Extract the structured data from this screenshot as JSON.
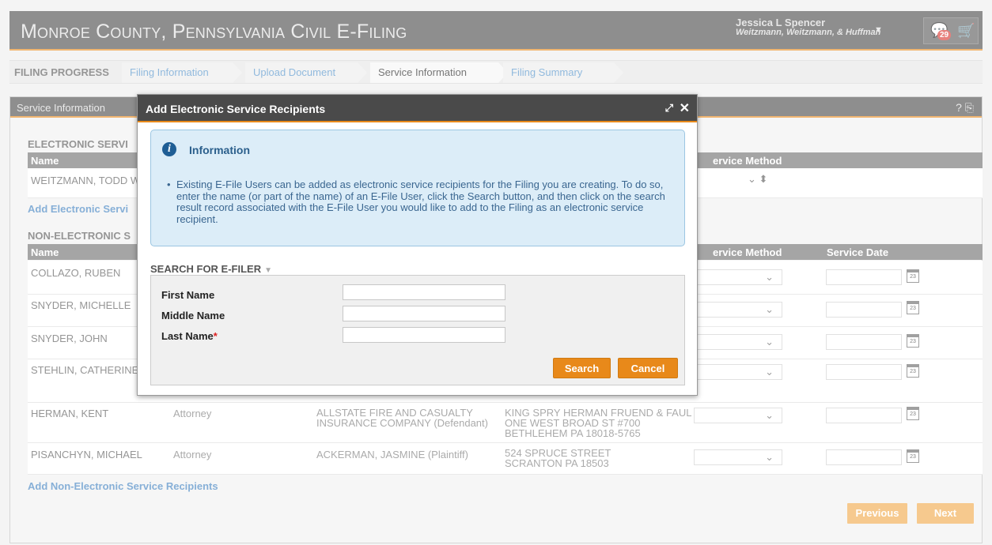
{
  "app": {
    "title": "Monroe County, Pennsylvania Civil E-Filing",
    "user_name": "Jessica L Spencer",
    "user_org": "Weitzmann, Weitzmann, & Huffman",
    "notification_count": "29",
    "icons": {
      "user_menu": "caret-down-icon",
      "messages": "chat-icon",
      "cart": "cart-icon"
    }
  },
  "progress": {
    "label": "FILING PROGRESS",
    "steps": [
      {
        "label": "Filing Information",
        "state": "link"
      },
      {
        "label": "Upload Document",
        "state": "link"
      },
      {
        "label": "Service Information",
        "state": "active"
      },
      {
        "label": "Filing Summary",
        "state": "link"
      }
    ]
  },
  "panel": {
    "title": "Service Information",
    "help_icon": "?",
    "electronic": {
      "heading": "ELECTRONIC SERVI",
      "columns": {
        "name": "Name",
        "service_method": "ervice Method"
      },
      "rows": [
        {
          "name": "WEITZMANN, TODD W"
        }
      ],
      "add_link": "Add Electronic Servi"
    },
    "non_electronic": {
      "heading": "NON-ELECTRONIC S",
      "columns": {
        "name": "Name",
        "service_method": "ervice Method",
        "service_date": "Service Date"
      },
      "rows": [
        {
          "name": "COLLAZO, RUBEN",
          "role": "",
          "party": "",
          "address": ""
        },
        {
          "name": "SNYDER, MICHELLE",
          "role": "",
          "party": "",
          "address": ""
        },
        {
          "name": "SNYDER, JOHN",
          "role": "",
          "party": "",
          "address": ""
        },
        {
          "name": "STEHLIN, CATHERINE",
          "role": "",
          "party": "",
          "address": ""
        },
        {
          "name": "HERMAN, KENT",
          "role": "Attorney",
          "party": "ALLSTATE FIRE AND CASUALTY INSURANCE COMPANY (Defendant)",
          "address": "KING SPRY HERMAN FRUEND & FAUL ONE WEST BROAD ST #700 BETHLEHEM PA 18018-5765"
        },
        {
          "name": "PISANCHYN, MICHAEL",
          "role": "Attorney",
          "party": "ACKERMAN, JASMINE (Plaintiff)",
          "address": "524 SPRUCE STREET SCRANTON PA 18503"
        }
      ],
      "add_link": "Add Non-Electronic Service Recipients"
    },
    "calendar_day": "23",
    "previous_label": "Previous",
    "next_label": "Next"
  },
  "modal": {
    "title": "Add Electronic Service Recipients",
    "info": {
      "title": "Information",
      "text": "Existing E-File Users can be added as electronic service recipients for the Filing you are creating. To do so, enter the name (or part of the name) of an E-File User, click the Search button, and then click on the search result record associated with the E-File User you would like to add to the Filing as an electronic service recipient."
    },
    "search": {
      "label": "SEARCH FOR E-FILER",
      "first_name_label": "First Name",
      "middle_name_label": "Middle Name",
      "last_name_label": "Last Name",
      "required_marker": "*",
      "first_name": "",
      "middle_name": "",
      "last_name": "",
      "search_label": "Search",
      "cancel_label": "Cancel"
    }
  },
  "colors": {
    "accent": "#e8891a",
    "header": "#4a4a4a",
    "link": "#3c7fbf",
    "info_bg": "#dcedf8"
  }
}
